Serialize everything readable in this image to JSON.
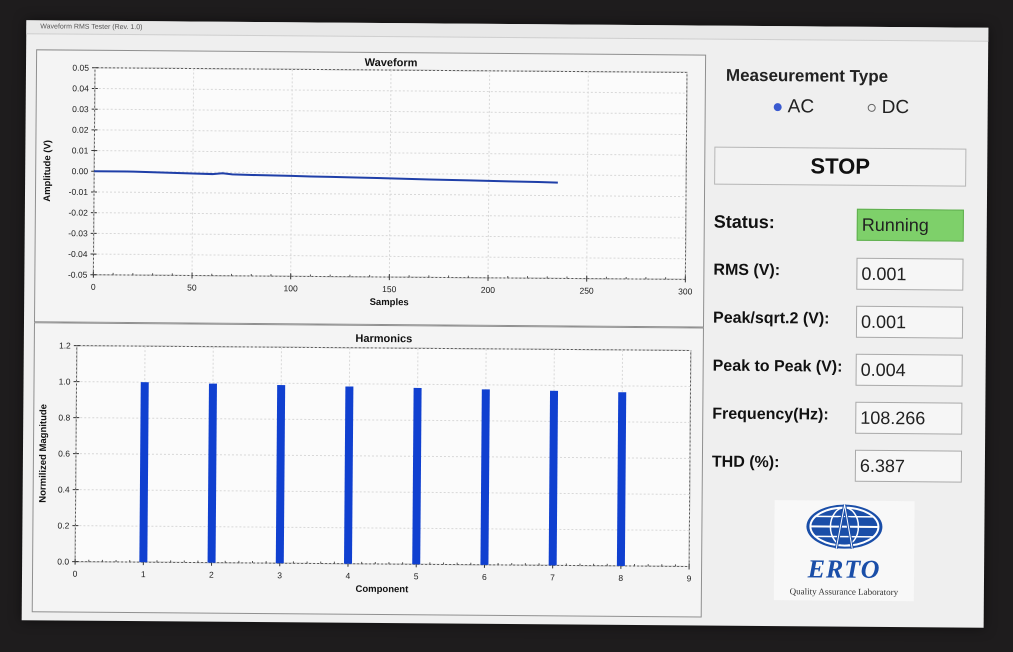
{
  "window": {
    "title": "Waveform RMS Tester (Rev. 1.0)"
  },
  "measurement": {
    "title": "Measeurement Type",
    "options": [
      {
        "label": "AC",
        "selected": true
      },
      {
        "label": "DC",
        "selected": false
      }
    ]
  },
  "stop_button": {
    "label": "STOP"
  },
  "status": {
    "label": "Status:",
    "value": "Running",
    "color": "#7ed06a"
  },
  "fields": [
    {
      "label": "RMS (V):",
      "value": "0.001"
    },
    {
      "label": "Peak/sqrt.2 (V):",
      "value": "0.001"
    },
    {
      "label": "Peak to Peak (V):",
      "value": "0.004"
    },
    {
      "label": "Frequency(Hz):",
      "value": "108.266"
    },
    {
      "label": "THD (%):",
      "value": "6.387"
    }
  ],
  "logo": {
    "name": "ERTO",
    "subtitle": "Quality Assurance Laboratory",
    "icon": "globe-tower-icon"
  },
  "chart_data": [
    {
      "type": "line",
      "title": "Waveform",
      "xlabel": "Samples",
      "ylabel": "Amplitude (V)",
      "xlim": [
        0,
        300
      ],
      "ylim": [
        -0.05,
        0.05
      ],
      "x_ticks": [
        "0",
        "50",
        "100",
        "150",
        "200",
        "250",
        "300"
      ],
      "y_ticks": [
        "0.05",
        "0.04",
        "0.03",
        "0.02",
        "0.01",
        "0.00",
        "-0.01",
        "-0.02",
        "-0.03",
        "-0.04",
        "-0.05"
      ],
      "grid": true,
      "color": "#1f3fa8",
      "x": [
        0,
        20,
        40,
        50,
        60,
        65,
        70,
        80,
        100,
        110,
        120,
        130,
        150,
        170,
        190,
        210,
        225,
        235
      ],
      "y": [
        0.0,
        0.0,
        -0.0005,
        -0.0007,
        -0.0009,
        -0.0005,
        -0.001,
        -0.0012,
        -0.0015,
        -0.0017,
        -0.0018,
        -0.002,
        -0.0023,
        -0.0027,
        -0.003,
        -0.0033,
        -0.0035,
        -0.0037
      ]
    },
    {
      "type": "bar",
      "title": "Harmonics",
      "xlabel": "Component",
      "ylabel": "Normilized Magnitude",
      "xlim": [
        0,
        9
      ],
      "ylim": [
        0,
        1.2
      ],
      "x_ticks": [
        "0",
        "1",
        "2",
        "3",
        "4",
        "5",
        "6",
        "7",
        "8",
        "9"
      ],
      "y_ticks": [
        "1.2",
        "1.0",
        "0.8",
        "0.6",
        "0.4",
        "0.2",
        "0.0"
      ],
      "grid": true,
      "color": "#1040d0",
      "categories": [
        1,
        2,
        3,
        4,
        5,
        6,
        7,
        8
      ],
      "values": [
        1.0,
        0.995,
        0.99,
        0.985,
        0.98,
        0.975,
        0.97,
        0.965
      ]
    }
  ]
}
